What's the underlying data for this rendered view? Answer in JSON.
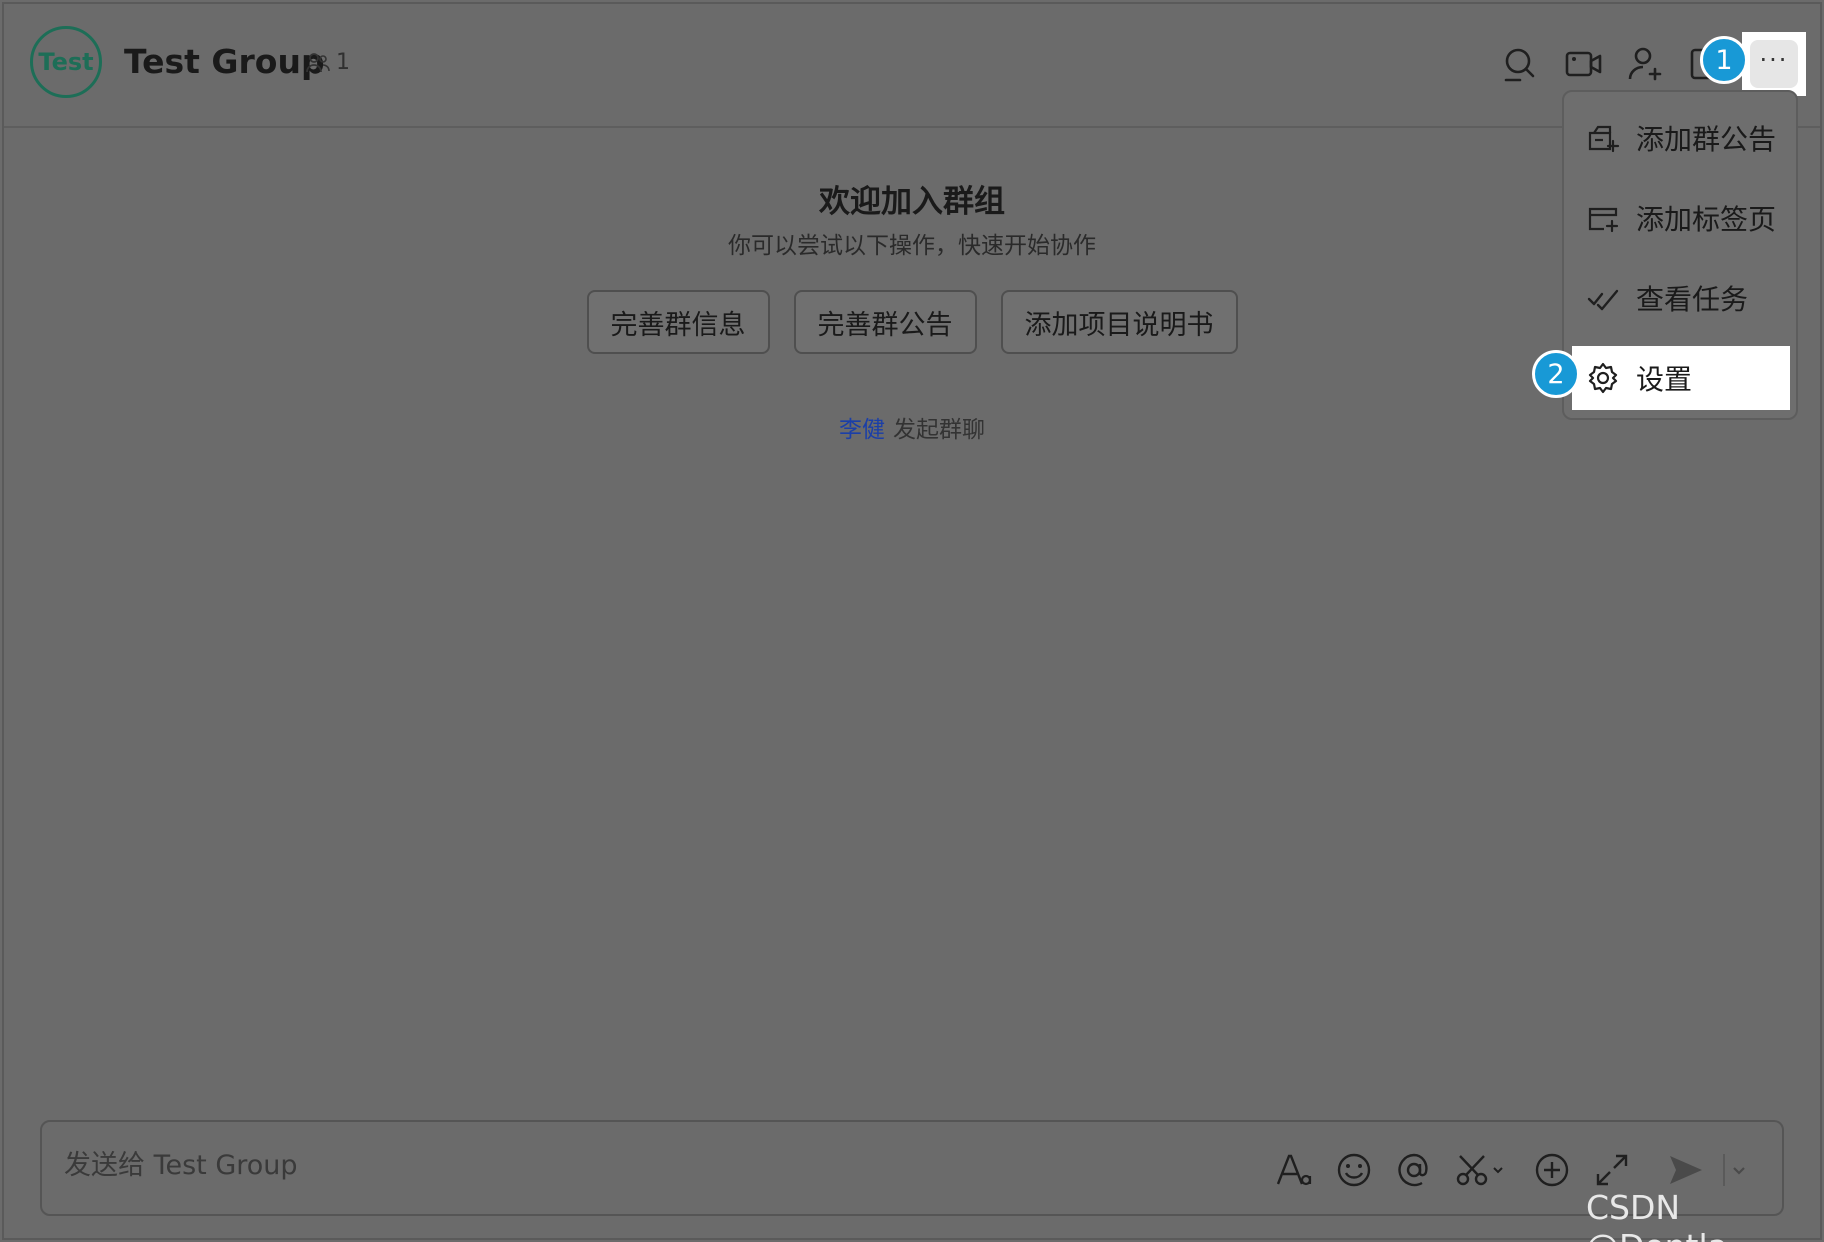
{
  "header": {
    "avatar_text": "Test",
    "title": "Test Group",
    "member_count": "1",
    "icons": [
      "search-icon",
      "video-icon",
      "add-member-icon",
      "board-icon",
      "more-icon"
    ],
    "more_label": "···"
  },
  "welcome": {
    "title": "欢迎加入群组",
    "subtitle": "你可以尝试以下操作，快速开始协作",
    "actions": [
      "完善群信息",
      "完善群公告",
      "添加项目说明书"
    ],
    "started_by": "李健",
    "started_text": "发起群聊"
  },
  "menu": {
    "items": [
      {
        "label": "添加群公告",
        "icon": "announcement-icon"
      },
      {
        "label": "添加标签页",
        "icon": "tab-add-icon"
      },
      {
        "label": "查看任务",
        "icon": "task-check-icon"
      },
      {
        "label": "设置",
        "icon": "gear-icon"
      }
    ]
  },
  "badges": {
    "first": "1",
    "second": "2"
  },
  "composer": {
    "placeholder": "发送给 Test Group",
    "tools": [
      "font-icon",
      "emoji-icon",
      "mention-icon",
      "scissors-icon",
      "plus-circle-icon",
      "expand-icon",
      "send-icon",
      "chevron-down-icon"
    ]
  },
  "watermark": "CSDN @Dontla",
  "colors": {
    "badge": "#1899d6",
    "avatar": "#1d6e57",
    "link": "#1b3fa8"
  }
}
